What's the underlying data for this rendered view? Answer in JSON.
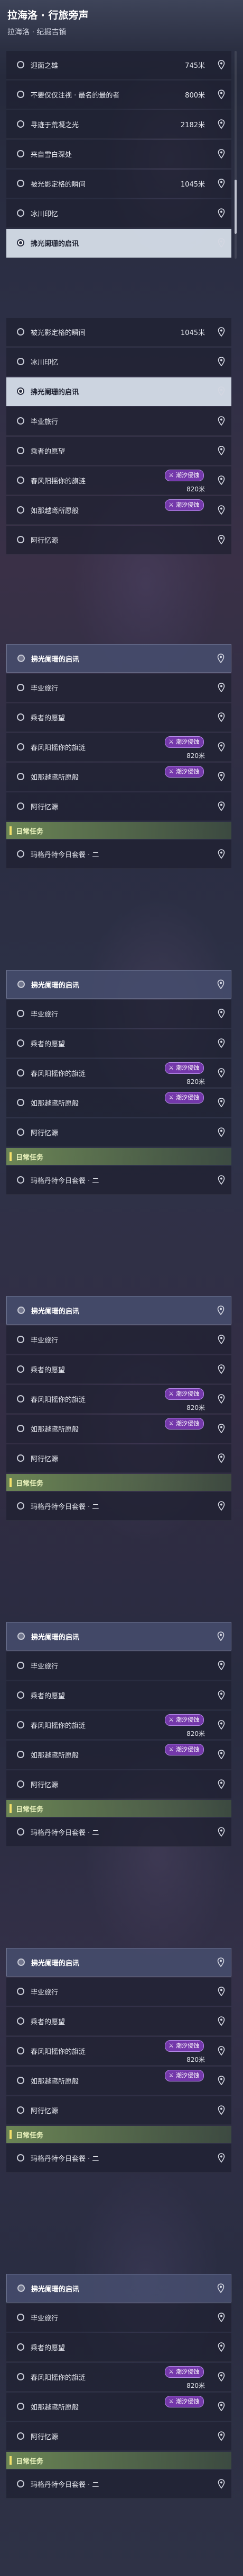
{
  "header": {
    "title": "拉海洛 · 行旅旁声",
    "subtitle": "拉海洛 · 纪掘吉镇"
  },
  "event_tag": "潮汐侵蚀",
  "icons": {
    "radio": "radio-circle-icon",
    "locate": "location-pin-icon",
    "event": "tide-erosion-icon"
  },
  "colors": {
    "selected_row": "#d8e1ec",
    "event_tag": "#8a3cbe",
    "daily_section": "#708c56"
  },
  "panels": [
    {
      "items": [
        {
          "kind": "row",
          "label": "迎面之雄",
          "distance": "745米"
        },
        {
          "kind": "row",
          "label": "不要仅仅注视 · 最名的最的者",
          "distance": "800米"
        },
        {
          "kind": "row",
          "label": "寻迹于荒凝之光",
          "distance": "2182米"
        },
        {
          "kind": "row",
          "label": "来自雪白深处"
        },
        {
          "kind": "row",
          "label": "被光影定格的瞬间",
          "distance": "1045米"
        },
        {
          "kind": "row",
          "label": "冰川印忆"
        },
        {
          "kind": "row",
          "label": "拂光阑珊的启讯",
          "state": "selected"
        }
      ],
      "scroll": true
    },
    {
      "items": [
        {
          "kind": "row",
          "label": "被光影定格的瞬间",
          "distance": "1045米"
        },
        {
          "kind": "row",
          "label": "冰川印忆"
        },
        {
          "kind": "row",
          "label": "拂光阑珊的启讯",
          "state": "selected"
        },
        {
          "kind": "row",
          "label": "毕业旅行"
        },
        {
          "kind": "row",
          "label": "乘者的愿望"
        },
        {
          "kind": "row",
          "label": "春风阳摇你的旗涟",
          "distance": "820米",
          "event": true
        },
        {
          "kind": "row",
          "label": "如那越鸢所愿般",
          "event": true
        },
        {
          "kind": "row",
          "label": "阿行忆源"
        }
      ]
    },
    {
      "items": [
        {
          "kind": "row",
          "label": "拂光阑珊的启讯",
          "state": "highlight"
        },
        {
          "kind": "row",
          "label": "毕业旅行"
        },
        {
          "kind": "row",
          "label": "乘者的愿望"
        },
        {
          "kind": "row",
          "label": "春风阳摇你的旗涟",
          "distance": "820米",
          "event": true
        },
        {
          "kind": "row",
          "label": "如那越鸢所愿般",
          "event": true
        },
        {
          "kind": "row",
          "label": "阿行忆源"
        },
        {
          "kind": "section",
          "label": "日常任务"
        },
        {
          "kind": "row",
          "label": "玛格丹特今日套餐 · 二"
        }
      ]
    },
    {
      "items": [
        {
          "kind": "row",
          "label": "拂光阑珊的启讯",
          "state": "highlight"
        },
        {
          "kind": "row",
          "label": "毕业旅行"
        },
        {
          "kind": "row",
          "label": "乘者的愿望"
        },
        {
          "kind": "row",
          "label": "春风阳摇你的旗涟",
          "distance": "820米",
          "event": true
        },
        {
          "kind": "row",
          "label": "如那越鸢所愿般",
          "event": true
        },
        {
          "kind": "row",
          "label": "阿行忆源"
        },
        {
          "kind": "section",
          "label": "日常任务"
        },
        {
          "kind": "row",
          "label": "玛格丹特今日套餐 · 二"
        }
      ]
    },
    {
      "items": [
        {
          "kind": "row",
          "label": "拂光阑珊的启讯",
          "state": "highlight"
        },
        {
          "kind": "row",
          "label": "毕业旅行"
        },
        {
          "kind": "row",
          "label": "乘者的愿望"
        },
        {
          "kind": "row",
          "label": "春风阳摇你的旗涟",
          "distance": "820米",
          "event": true
        },
        {
          "kind": "row",
          "label": "如那越鸢所愿般",
          "event": true
        },
        {
          "kind": "row",
          "label": "阿行忆源"
        },
        {
          "kind": "section",
          "label": "日常任务"
        },
        {
          "kind": "row",
          "label": "玛格丹特今日套餐 · 二"
        }
      ]
    },
    {
      "items": [
        {
          "kind": "row",
          "label": "拂光阑珊的启讯",
          "state": "highlight"
        },
        {
          "kind": "row",
          "label": "毕业旅行"
        },
        {
          "kind": "row",
          "label": "乘者的愿望"
        },
        {
          "kind": "row",
          "label": "春风阳摇你的旗涟",
          "distance": "820米",
          "event": true
        },
        {
          "kind": "row",
          "label": "如那越鸢所愿般",
          "event": true
        },
        {
          "kind": "row",
          "label": "阿行忆源"
        },
        {
          "kind": "section",
          "label": "日常任务"
        },
        {
          "kind": "row",
          "label": "玛格丹特今日套餐 · 二"
        }
      ]
    },
    {
      "items": [
        {
          "kind": "row",
          "label": "拂光阑珊的启讯",
          "state": "highlight"
        },
        {
          "kind": "row",
          "label": "毕业旅行"
        },
        {
          "kind": "row",
          "label": "乘者的愿望"
        },
        {
          "kind": "row",
          "label": "春风阳摇你的旗涟",
          "distance": "820米",
          "event": true
        },
        {
          "kind": "row",
          "label": "如那越鸢所愿般",
          "event": true
        },
        {
          "kind": "row",
          "label": "阿行忆源"
        },
        {
          "kind": "section",
          "label": "日常任务"
        },
        {
          "kind": "row",
          "label": "玛格丹特今日套餐 · 二"
        }
      ]
    },
    {
      "items": [
        {
          "kind": "row",
          "label": "拂光阑珊的启讯",
          "state": "highlight"
        },
        {
          "kind": "row",
          "label": "毕业旅行"
        },
        {
          "kind": "row",
          "label": "乘者的愿望"
        },
        {
          "kind": "row",
          "label": "春风阳摇你的旗涟",
          "distance": "820米",
          "event": true
        },
        {
          "kind": "row",
          "label": "如那越鸢所愿般",
          "event": true
        },
        {
          "kind": "row",
          "label": "阿行忆源"
        },
        {
          "kind": "section",
          "label": "日常任务"
        },
        {
          "kind": "row",
          "label": "玛格丹特今日套餐 · 二"
        }
      ]
    }
  ]
}
